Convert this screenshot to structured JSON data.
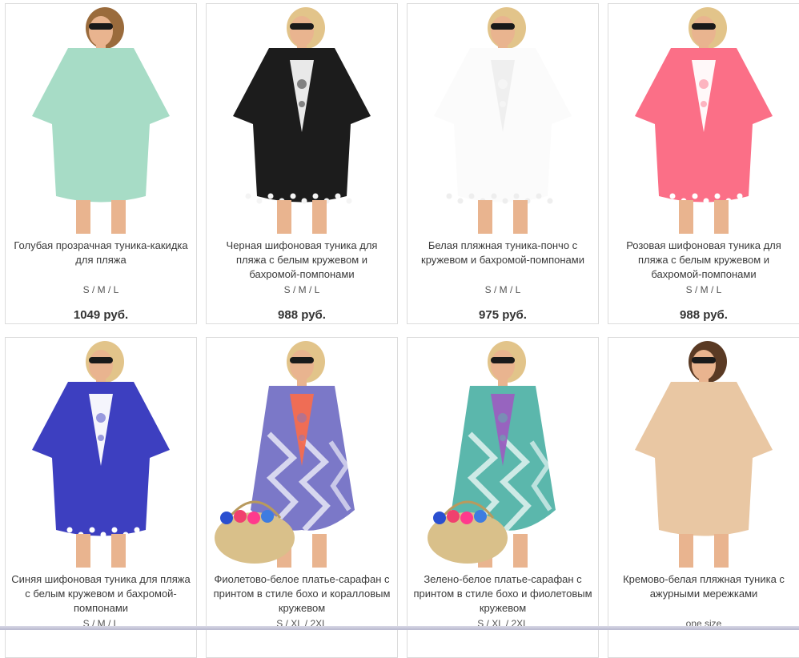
{
  "products": [
    {
      "title": "Голубая прозрачная туника-какидка для пляжа",
      "sizes": "S / M / L",
      "price": "1049 руб.",
      "dress_color": "#a7dcc6",
      "trim_color": "#e9f5ef",
      "hair_color": "#9a6b3c"
    },
    {
      "title": "Черная шифоновая туника для пляжа с белым кружевом и бахромой-помпонами",
      "sizes": "S / M / L",
      "price": "988 руб.",
      "dress_color": "#1c1c1c",
      "trim_color": "#f4f4f4",
      "hair_color": "#e2c48a"
    },
    {
      "title": "Белая пляжная туника-пончо с кружевом и бахромой-помпонами",
      "sizes": "S / M / L",
      "price": "975 руб.",
      "dress_color": "#fbfbfb",
      "trim_color": "#eeeeee",
      "hair_color": "#e2c48a"
    },
    {
      "title": "Розовая шифоновая туника для пляжа с белым кружевом и бахромой-помпонами",
      "sizes": "S / M / L",
      "price": "988 руб.",
      "dress_color": "#fb6f87",
      "trim_color": "#ffffff",
      "hair_color": "#e2c48a"
    },
    {
      "title": "Синяя шифоновая туника для пляжа с белым кружевом и бахромой-помпонами",
      "sizes": "S / M / L",
      "price": "",
      "dress_color": "#3d3fc0",
      "trim_color": "#ffffff",
      "hair_color": "#e2c48a"
    },
    {
      "title": "Фиолетово-белое платье-сарафан с принтом в стиле бохо и коралловым кружевом",
      "sizes": "S / XL / 2XL",
      "price": "",
      "dress_color": "#7b78c8",
      "trim_color": "#f56d4f",
      "hair_color": "#e2c48a"
    },
    {
      "title": "Зелено-белое платье-сарафан с принтом в стиле бохо и фиолетовым кружевом",
      "sizes": "S / XL / 2XL",
      "price": "",
      "dress_color": "#5bb7ac",
      "trim_color": "#9b5fc0",
      "hair_color": "#e2c48a"
    },
    {
      "title": "Кремово-белая пляжная туника с ажурными мережками",
      "sizes": "one size",
      "price": "",
      "dress_color": "#e9c7a3",
      "trim_color": "#a47a52",
      "hair_color": "#5a3a24"
    }
  ]
}
